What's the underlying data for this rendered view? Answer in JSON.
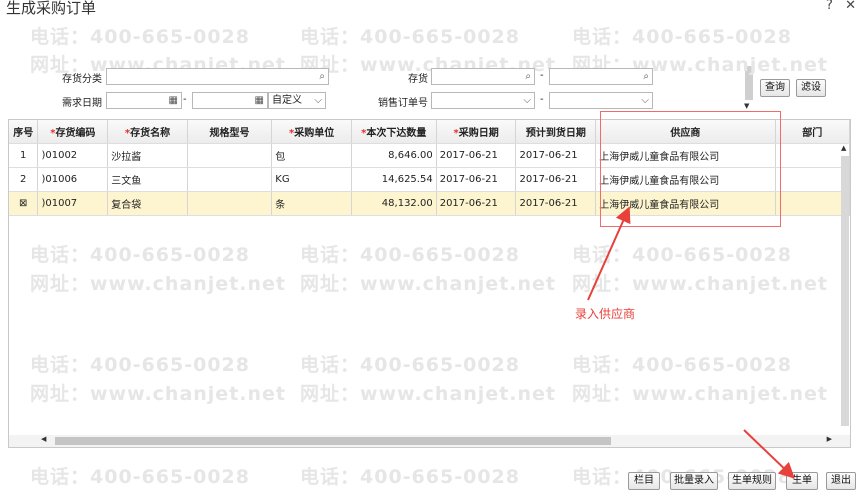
{
  "window": {
    "title": "生成采购订单",
    "help_icon": "?",
    "close_icon": "✕"
  },
  "watermark": {
    "phone": "电话：400-665-0028",
    "site": "网址：www.chanjet.net"
  },
  "filters": {
    "category_label": "存货分类",
    "date_label": "需求日期",
    "date_mode": "自定义",
    "item_label": "存货",
    "sales_order_label": "销售订单号",
    "range_dash": "-",
    "query_button": "查询",
    "filter_button": "滤设"
  },
  "table": {
    "columns": [
      {
        "label": "序号",
        "required": false
      },
      {
        "label": "存货编码",
        "required": true
      },
      {
        "label": "存货名称",
        "required": true
      },
      {
        "label": "规格型号",
        "required": false
      },
      {
        "label": "采购单位",
        "required": true
      },
      {
        "label": "本次下达数量",
        "required": true
      },
      {
        "label": "采购日期",
        "required": true
      },
      {
        "label": "预计到货日期",
        "required": false
      },
      {
        "label": "供应商",
        "required": false
      },
      {
        "label": "部门",
        "required": false
      }
    ],
    "rows": [
      {
        "idx": "1",
        "code": ")01002",
        "name": "沙拉酱",
        "spec": "",
        "unit": "包",
        "qty": "8,646.00",
        "date": "2017-06-21",
        "eta": "2017-06-21",
        "vendor": "上海伊威儿童食品有限公司",
        "dept": ""
      },
      {
        "idx": "2",
        "code": ")01006",
        "name": "三文鱼",
        "spec": "",
        "unit": "KG",
        "qty": "14,625.54",
        "date": "2017-06-21",
        "eta": "2017-06-21",
        "vendor": "上海伊威儿童食品有限公司",
        "dept": ""
      },
      {
        "idx": "",
        "code": ")01007",
        "name": "复合袋",
        "spec": "",
        "unit": "条",
        "qty": "48,132.00",
        "date": "2017-06-21",
        "eta": "2017-06-21",
        "vendor": "上海伊威儿童食品有限公司",
        "dept": ""
      }
    ],
    "selected_row_icon": "⊠"
  },
  "annotation": {
    "note": "录入供应商",
    "color": "#e8403a"
  },
  "footer": {
    "columns": "栏目",
    "batch_entry": "批量录入",
    "rules": "生单规则",
    "generate": "生单",
    "exit": "退出"
  }
}
